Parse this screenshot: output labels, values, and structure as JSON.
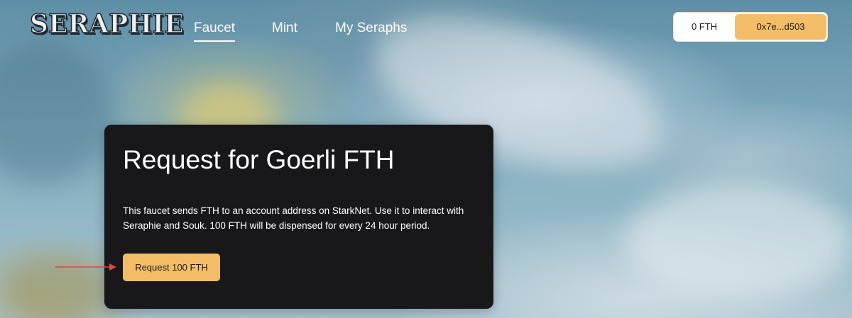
{
  "header": {
    "logo_text": "SERAPHIE",
    "nav": [
      {
        "label": "Faucet",
        "active": true
      },
      {
        "label": "Mint",
        "active": false
      },
      {
        "label": "My Seraphs",
        "active": false
      }
    ],
    "wallet": {
      "balance": "0 FTH",
      "address": "0x7e...d503"
    }
  },
  "card": {
    "title": "Request for Goerli FTH",
    "description": "This faucet sends FTH to an account address on StarkNet. Use it to interact with Seraphie and Souk. 100 FTH will be dispensed for every 24 hour period.",
    "button_label": "Request 100 FTH"
  },
  "colors": {
    "accent": "#f3bd67",
    "card_bg": "#18171a",
    "annotation_arrow": "#e0473a"
  },
  "icons": {
    "annotation": "arrow-right-icon"
  }
}
